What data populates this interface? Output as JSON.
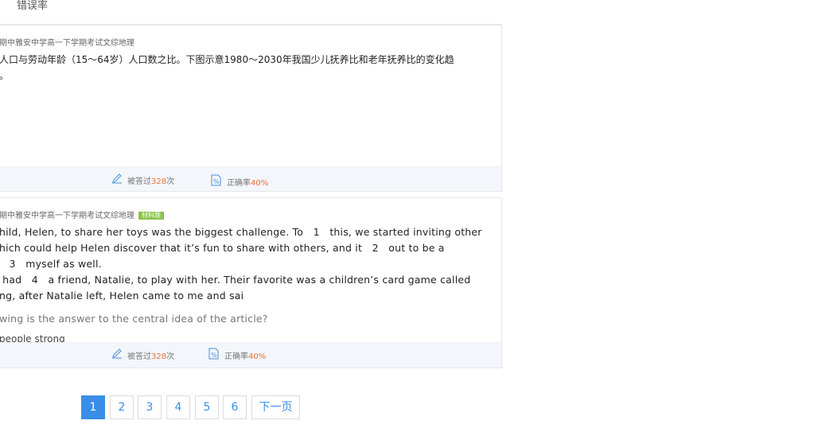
{
  "header": {
    "sort_label": "错误率"
  },
  "questions": [
    {
      "source": "期中雅安中学高一下学期考试文综地理",
      "tag": "",
      "text": "人口与劳动年龄（15～64岁）人口数之比。下图示意1980～2030年我国少儿抚养比和老年抚养比的变化趋\n。",
      "subquestion": "",
      "option": "",
      "answered_prefix": "被答过",
      "answered_count": "328",
      "answered_suffix": "次",
      "rate_label": "正确率",
      "rate_value": "40%"
    },
    {
      "source": "期中雅安中学高一下学期考试文综地理",
      "tag": "材料题",
      "text": "hild, Helen, to share her toys was the biggest challenge. To   1   this, we started inviting other\nhich could help Helen discover that it’s fun to share with others, and it   2   out to be a\n   3   myself as well.\n had   4   a friend, Natalie, to play with her. Their favorite was a children’s card game called\nng, after Natalie left, Helen came to me and sai",
      "subquestion": "wing is the answer to the central idea of the article?",
      "option": "people strong",
      "answered_prefix": "被答过",
      "answered_count": "328",
      "answered_suffix": "次",
      "rate_label": "正确率",
      "rate_value": "40%"
    }
  ],
  "pagination": {
    "pages": [
      "1",
      "2",
      "3",
      "4",
      "5",
      "6"
    ],
    "current": "1",
    "next_label": "下一页"
  },
  "colors": {
    "accent": "#3a8ee6",
    "highlight": "#f0703a",
    "tag": "#8bc34a"
  }
}
